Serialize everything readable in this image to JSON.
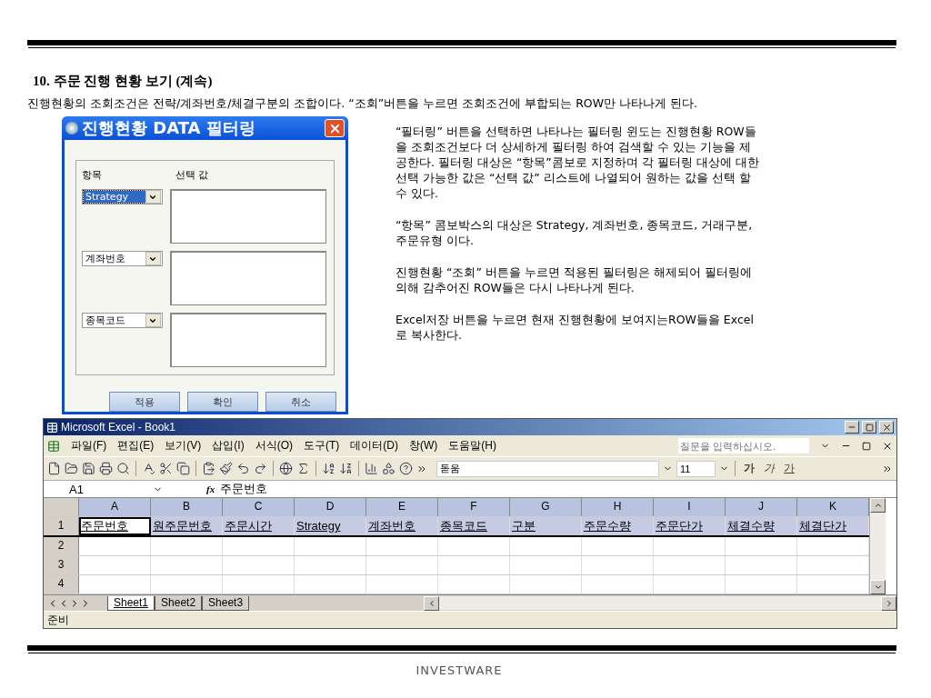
{
  "section_title": "10. 주문 진행 현황 보기 (계속)",
  "intro": "진행현황의 조회조건은 전략/계좌번호/체결구분의 조합이다. “조회”버튼을 누르면 조회조건에 부합되는 ROW만 나타나게 된다.",
  "dialog": {
    "title": "진행현황 DATA 필터링",
    "header_item": "항목",
    "header_value": "선택 값",
    "rows": [
      {
        "combo": "Strategy",
        "highlighted": true
      },
      {
        "combo": "계좌번호",
        "highlighted": false
      },
      {
        "combo": "종목코드",
        "highlighted": false
      }
    ],
    "buttons": [
      "적용",
      "확인",
      "취소"
    ]
  },
  "description": [
    "“필터링” 버튼을 선택하면 나타나는 필터링 윈도는 진행현황 ROW들을 조회조건보다 더 상세하게 필터링 하여 검색할 수 있는 기능을 제공한다. 필터링 대상은 “항목”콤보로 지정하며 각 필터링 대상에 대한 선택 가능한 값은 “선택 값” 리스트에 나열되어 원하는 값을 선택 할 수 있다.",
    "“항목” 콤보박스의 대상은 Strategy, 계좌번호, 종목코드, 거래구분, 주문유형 이다.",
    "진행현황 “조회” 버튼을 누르면 적용된 필터링은 해제되어 필터링에 의해 감추어진 ROW들은 다시 나타나게 된다.",
    "Excel저장 버튼을 누르면 현재 진행현황에 보여지는ROW들을 Excel로 복사한다."
  ],
  "excel": {
    "title": "Microsoft Excel - Book1",
    "menu": [
      "파일(F)",
      "편집(E)",
      "보기(V)",
      "삽입(I)",
      "서식(O)",
      "도구(T)",
      "데이터(D)",
      "창(W)",
      "도움말(H)"
    ],
    "help_placeholder": "질문을 입력하십시오.",
    "font": "돋움",
    "font_size": "11",
    "format_buttons": [
      {
        "label": "가",
        "kind": "bold"
      },
      {
        "label": "가",
        "kind": "italic"
      },
      {
        "label": "가",
        "kind": "underline"
      }
    ],
    "cell_ref": "A1",
    "fx": "fx",
    "formula": "주문번호",
    "columns": [
      "A",
      "B",
      "C",
      "D",
      "E",
      "F",
      "G",
      "H",
      "I",
      "J",
      "K"
    ],
    "rows": [
      {
        "number": "1",
        "cells": [
          {
            "text": "주문번호",
            "selected": true
          },
          {
            "text": "원주문번호",
            "selected": false
          },
          {
            "text": "주문시간",
            "selected": false
          },
          {
            "text": "Strategy",
            "selected": false
          },
          {
            "text": "계좌번호",
            "selected": false
          },
          {
            "text": "종목코드",
            "selected": false
          },
          {
            "text": "구분",
            "selected": false
          },
          {
            "text": "주문수량",
            "selected": false
          },
          {
            "text": "주문단가",
            "selected": false
          },
          {
            "text": "체결수량",
            "selected": false
          },
          {
            "text": "체결단가",
            "selected": false
          }
        ]
      },
      {
        "number": "2"
      },
      {
        "number": "3"
      },
      {
        "number": "4"
      }
    ],
    "sheets": [
      {
        "label": "Sheet1",
        "selected": true
      },
      {
        "label": "Sheet2",
        "selected": false
      },
      {
        "label": "Sheet3",
        "selected": false
      }
    ],
    "status": "준비"
  },
  "footer": {
    "logo": "INVESTWARE"
  }
}
